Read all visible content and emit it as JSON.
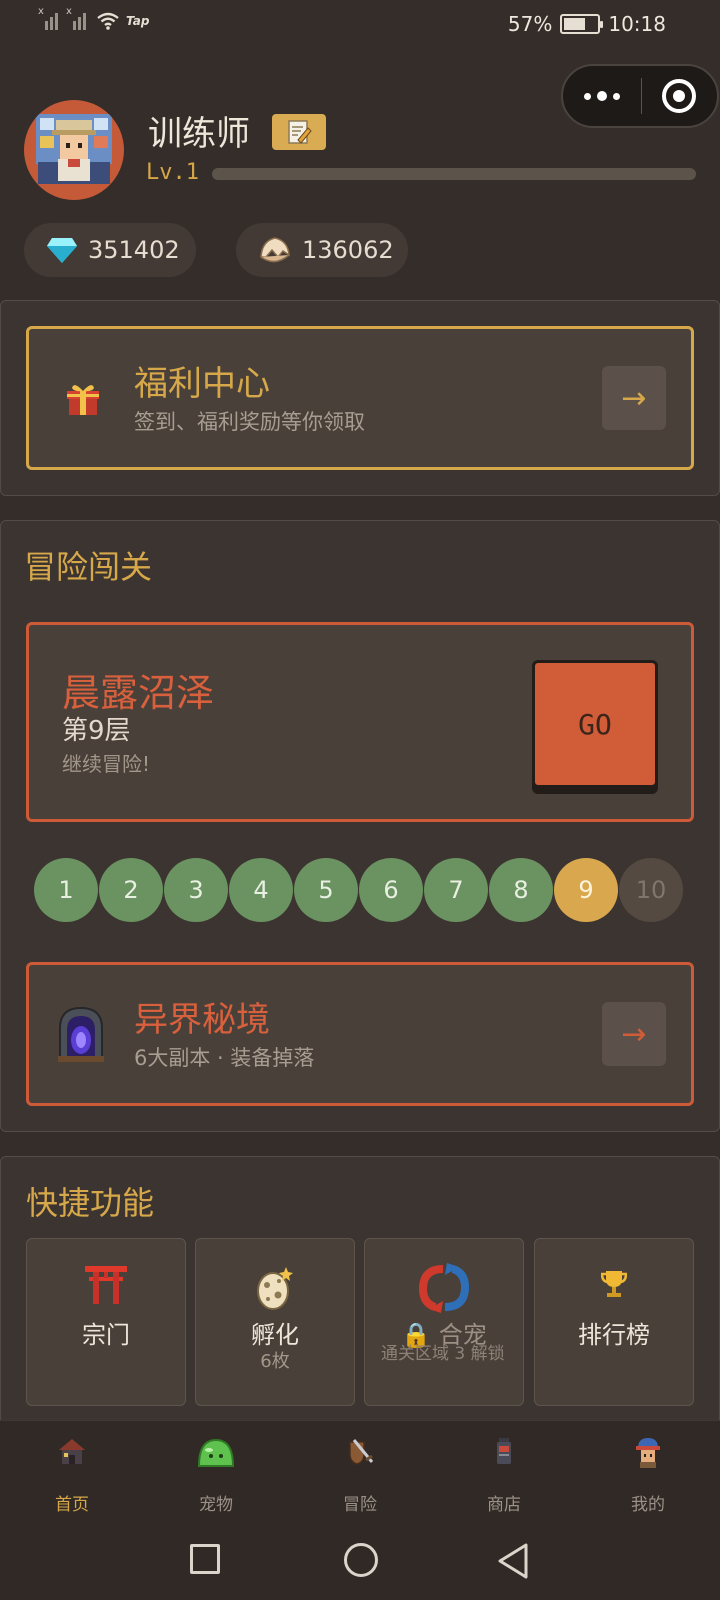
{
  "status_bar": {
    "carrier_mark_1": "x",
    "carrier_mark_2": "x",
    "tap_label": "Tap",
    "battery": "57%",
    "time": "10:18"
  },
  "profile": {
    "name": "训练师",
    "level": "Lv.1",
    "xp_fraction": 0.0
  },
  "currency": {
    "gems": "351402",
    "eggs": "136062"
  },
  "welfare": {
    "title": "福利中心",
    "subtitle": "签到、福利奖励等你领取",
    "arrow": "→"
  },
  "adventure": {
    "section_title": "冒险闯关",
    "stage_name": "晨露沼泽",
    "floor": "第9层",
    "hint": "继续冒险!",
    "go_label": "GO",
    "levels": [
      {
        "label": "1",
        "state": "cleared"
      },
      {
        "label": "2",
        "state": "cleared"
      },
      {
        "label": "3",
        "state": "cleared"
      },
      {
        "label": "4",
        "state": "cleared"
      },
      {
        "label": "5",
        "state": "cleared"
      },
      {
        "label": "6",
        "state": "cleared"
      },
      {
        "label": "7",
        "state": "cleared"
      },
      {
        "label": "8",
        "state": "cleared"
      },
      {
        "label": "9",
        "state": "current"
      },
      {
        "label": "10",
        "state": "locked"
      }
    ]
  },
  "realm": {
    "title": "异界秘境",
    "subtitle": "6大副本 · 装备掉落",
    "arrow": "→"
  },
  "quick": {
    "section_title": "快捷功能",
    "tiles": [
      {
        "label": "宗门",
        "sub": "",
        "icon": "torii-gate-icon"
      },
      {
        "label": "孵化",
        "sub": "6枚",
        "icon": "egg-icon"
      },
      {
        "label": "🔒 合宠",
        "sub": "通关区域 3 解锁",
        "icon": "swap-arrows-icon"
      },
      {
        "label": "排行榜",
        "sub": "",
        "icon": "trophy-icon"
      }
    ]
  },
  "nav": {
    "items": [
      {
        "label": "首页",
        "icon": "home-icon"
      },
      {
        "label": "宠物",
        "icon": "slime-icon"
      },
      {
        "label": "冒险",
        "icon": "sword-shield-icon"
      },
      {
        "label": "商店",
        "icon": "shop-icon"
      },
      {
        "label": "我的",
        "icon": "profile-icon"
      }
    ],
    "active_index": 0
  },
  "colors": {
    "background": "#342d29",
    "gold": "#d6a84a",
    "red_orange": "#d05c38",
    "cleared_green": "#6b9261",
    "current_gold": "#d9a84e",
    "locked_grey": "#544a42"
  }
}
